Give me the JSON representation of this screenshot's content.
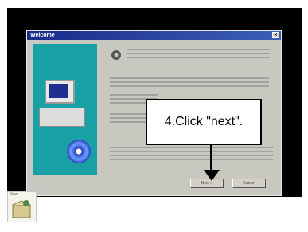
{
  "dialog": {
    "title": "Welcome",
    "close_glyph": "×",
    "next_label": "Next >",
    "cancel_label": "Cancel"
  },
  "callout": {
    "text": "4.Click \"next\"."
  },
  "desktop_icon": {
    "label": "New"
  },
  "colors": {
    "titlebar": "#1a2a8a",
    "art_panel": "#17a1a4",
    "dialog_bg": "#c8c8c0"
  }
}
